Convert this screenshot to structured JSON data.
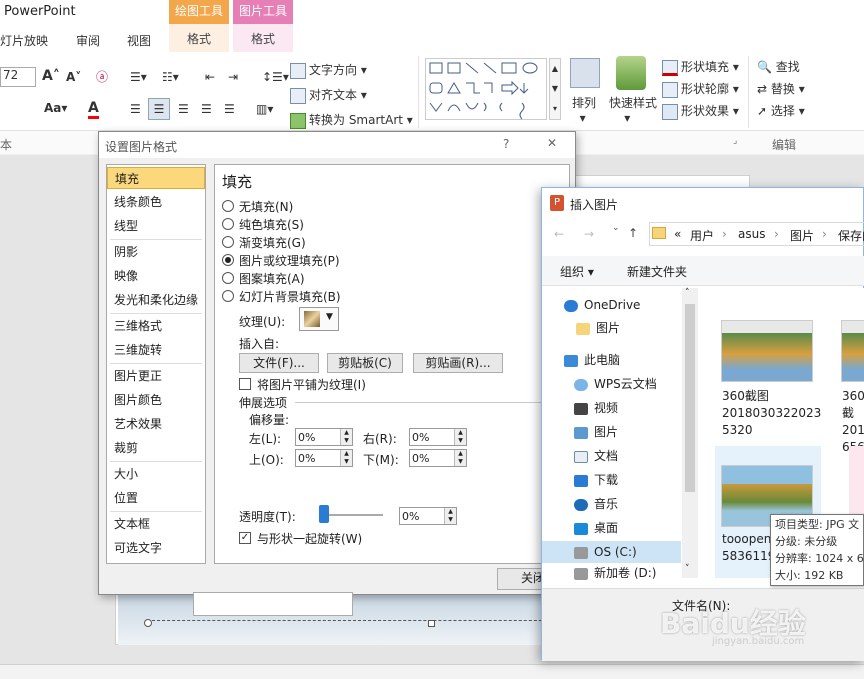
{
  "app": {
    "title": "PowerPoint"
  },
  "ribbon": {
    "tabs": [
      "灯片放映",
      "审阅",
      "视图"
    ],
    "context_tabs": [
      {
        "header": "绘图工具",
        "tab": "格式",
        "color": "#f3a64a"
      },
      {
        "header": "图片工具",
        "tab": "格式",
        "color": "#e57fb6"
      }
    ],
    "font_size": "72",
    "font_grow": "A",
    "font_shrink": "A",
    "aa": "Aa",
    "text_direction": "文字方向",
    "align_text": "对齐文本",
    "convert_smartart": "转换为 SmartArt",
    "arrange": "排列",
    "quick_styles": "快速样式",
    "shape_fill": "形状填充",
    "shape_outline": "形状轮廓",
    "shape_effects": "形状效果",
    "find": "查找",
    "replace": "替换",
    "select": "选择",
    "group_edit": "编辑",
    "group_left": "本"
  },
  "format_dialog": {
    "title": "设置图片格式",
    "help": "?",
    "close": "✕",
    "nav": [
      "填充",
      "线条颜色",
      "线型",
      "阴影",
      "映像",
      "发光和柔化边缘",
      "三维格式",
      "三维旋转",
      "图片更正",
      "图片颜色",
      "艺术效果",
      "裁剪",
      "大小",
      "位置",
      "文本框",
      "可选文字"
    ],
    "selected_nav": "填充",
    "section_title": "填充",
    "options": [
      "无填充(N)",
      "纯色填充(S)",
      "渐变填充(G)",
      "图片或纹理填充(P)",
      "图案填充(A)",
      "幻灯片背景填充(B)"
    ],
    "selected_option": "图片或纹理填充(P)",
    "texture_label": "纹理(U):",
    "insert_from": "插入自:",
    "btn_file": "文件(F)...",
    "btn_clipboard": "剪贴板(C)",
    "btn_clipart": "剪贴画(R)...",
    "tile_label": "将图片平铺为纹理(I)",
    "stretch_label": "伸展选项",
    "offset_label": "偏移量:",
    "left_label": "左(L):",
    "left_val": "0%",
    "right_label": "右(R):",
    "right_val": "0%",
    "top_label": "上(O):",
    "top_val": "0%",
    "bottom_label": "下(M):",
    "bottom_val": "0%",
    "transparency_label": "透明度(T):",
    "transparency_val": "0%",
    "transparency_level": 0,
    "rotate_label": "与形状一起旋转(W)",
    "close_btn": "关闭"
  },
  "insert_dialog": {
    "title": "插入图片",
    "breadcrumb": [
      "«",
      "用户",
      "asus",
      "图片",
      "保存的"
    ],
    "organize": "组织",
    "new_folder": "新建文件夹",
    "tree": [
      {
        "label": "OneDrive",
        "icon": "cloud-icon"
      },
      {
        "label": "图片",
        "icon": "folder-icon"
      },
      {
        "label": "此电脑",
        "icon": "computer-icon"
      },
      {
        "label": "WPS云文档",
        "icon": "cloud-icon"
      },
      {
        "label": "视频",
        "icon": "video-icon"
      },
      {
        "label": "图片",
        "icon": "pictures-icon"
      },
      {
        "label": "文档",
        "icon": "document-icon"
      },
      {
        "label": "下载",
        "icon": "download-icon"
      },
      {
        "label": "音乐",
        "icon": "music-icon"
      },
      {
        "label": "桌面",
        "icon": "desktop-icon"
      },
      {
        "label": "OS (C:)",
        "icon": "drive-icon"
      },
      {
        "label": "新加卷 (D:)",
        "icon": "drive-icon"
      }
    ],
    "files": [
      {
        "name1": "360截图",
        "name2": "2018030322023",
        "name3": "5320"
      },
      {
        "name1": "360截",
        "name2": "2018",
        "name3": "6565"
      },
      {
        "name1": "tooopen",
        "name2": "5836119",
        "name3": ""
      }
    ],
    "tooltip": [
      "项目类型: JPG 文",
      "分级: 未分级",
      "分辨率: 1024 x 6",
      "大小: 192 KB"
    ],
    "filename_label": "文件名(N):"
  },
  "watermark": {
    "text": "Baidu经验",
    "url": "jingyan.baidu.com"
  }
}
